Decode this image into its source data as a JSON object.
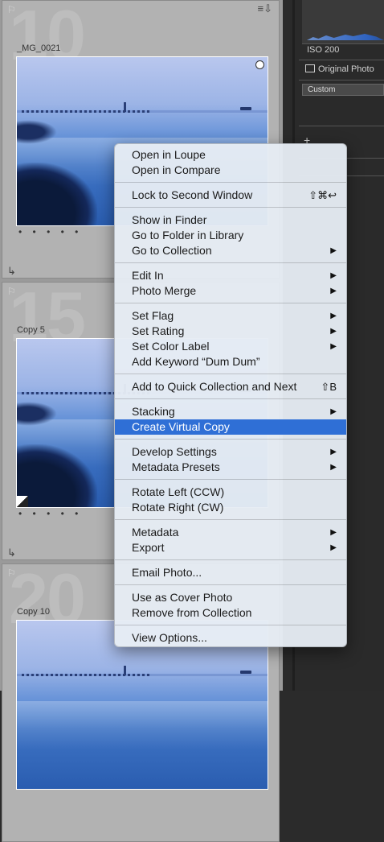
{
  "grid": {
    "cells": [
      {
        "number": "10",
        "name": "_MG_0021"
      },
      {
        "number": "15",
        "name": "Copy 5"
      },
      {
        "number": "20",
        "name": "Copy 10"
      }
    ],
    "dots": "• • • • •"
  },
  "right_panel": {
    "iso": "ISO 200",
    "original_photo": "Original Photo",
    "preset": "Custom"
  },
  "menu": {
    "groups": [
      [
        {
          "label": "Open in Loupe"
        },
        {
          "label": "Open in Compare"
        }
      ],
      [
        {
          "label": "Lock to Second Window",
          "shortcut": "⇧⌘↩"
        }
      ],
      [
        {
          "label": "Show in Finder"
        },
        {
          "label": "Go to Folder in Library"
        },
        {
          "label": "Go to Collection",
          "submenu": true
        }
      ],
      [
        {
          "label": "Edit In",
          "submenu": true
        },
        {
          "label": "Photo Merge",
          "submenu": true
        }
      ],
      [
        {
          "label": "Set Flag",
          "submenu": true
        },
        {
          "label": "Set Rating",
          "submenu": true
        },
        {
          "label": "Set Color Label",
          "submenu": true
        },
        {
          "label": "Add Keyword “Dum Dum”"
        }
      ],
      [
        {
          "label": "Add to Quick Collection and Next",
          "shortcut": "⇧B"
        }
      ],
      [
        {
          "label": "Stacking",
          "submenu": true
        },
        {
          "label": "Create Virtual Copy",
          "highlighted": true
        }
      ],
      [
        {
          "label": "Develop Settings",
          "submenu": true
        },
        {
          "label": "Metadata Presets",
          "submenu": true
        }
      ],
      [
        {
          "label": "Rotate Left (CCW)"
        },
        {
          "label": "Rotate Right (CW)"
        }
      ],
      [
        {
          "label": "Metadata",
          "submenu": true
        },
        {
          "label": "Export",
          "submenu": true
        }
      ],
      [
        {
          "label": "Email Photo..."
        }
      ],
      [
        {
          "label": "Use as Cover Photo"
        },
        {
          "label": "Remove from Collection"
        }
      ],
      [
        {
          "label": "View Options..."
        }
      ]
    ],
    "submenu_arrow": "▶",
    "highlight_color": "#2f6fd6"
  }
}
